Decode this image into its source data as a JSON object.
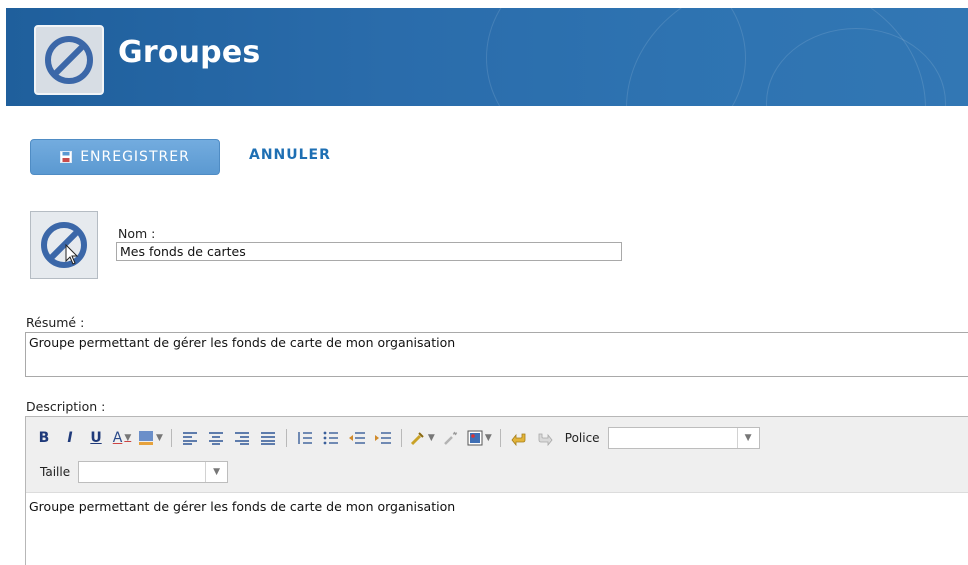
{
  "header": {
    "title": "Groupes",
    "icon": "no-entry-icon"
  },
  "actions": {
    "save_label": "ENREGISTRER",
    "save_icon": "floppy-disk-icon",
    "cancel_label": "ANNULER"
  },
  "form": {
    "thumbnail_icon": "no-entry-icon",
    "name_label": "Nom :",
    "name_value": "Mes fonds de cartes",
    "summary_label": "Résumé :",
    "summary_value": "Groupe permettant de gérer les fonds de carte de mon organisation",
    "description_label": "Description :"
  },
  "editor": {
    "toolbar": {
      "bold": "B",
      "italic": "I",
      "underline": "U",
      "font_color": "A",
      "font_label": "Police",
      "font_value": "",
      "size_label": "Taille",
      "size_value": ""
    },
    "content": "Groupe permettant de gérer les fonds de carte de mon organisation"
  },
  "colors": {
    "header_bg": "#2a6cab",
    "accent": "#1e6fb3",
    "save_button": "#5b99d1"
  }
}
